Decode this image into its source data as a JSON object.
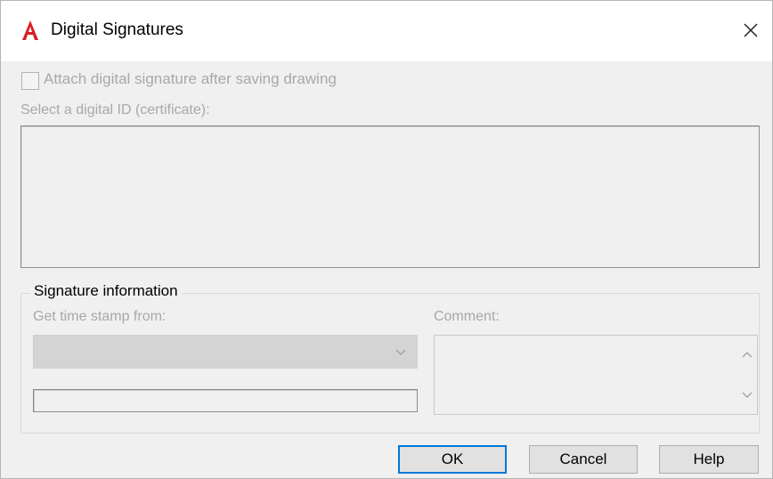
{
  "window": {
    "title": "Digital Signatures",
    "icon": "autocad-a-icon",
    "accent_color": "#d91f26"
  },
  "attach": {
    "label": "Attach digital signature after saving drawing",
    "checked": false,
    "enabled": false
  },
  "certificate": {
    "label": "Select a digital ID (certificate):",
    "items": []
  },
  "signature_info": {
    "group_title": "Signature information",
    "timestamp_label": "Get time stamp from:",
    "timestamp_selected": "",
    "timestamp_text": "",
    "comment_label": "Comment:",
    "comment_value": ""
  },
  "buttons": {
    "ok": "OK",
    "cancel": "Cancel",
    "help": "Help"
  }
}
